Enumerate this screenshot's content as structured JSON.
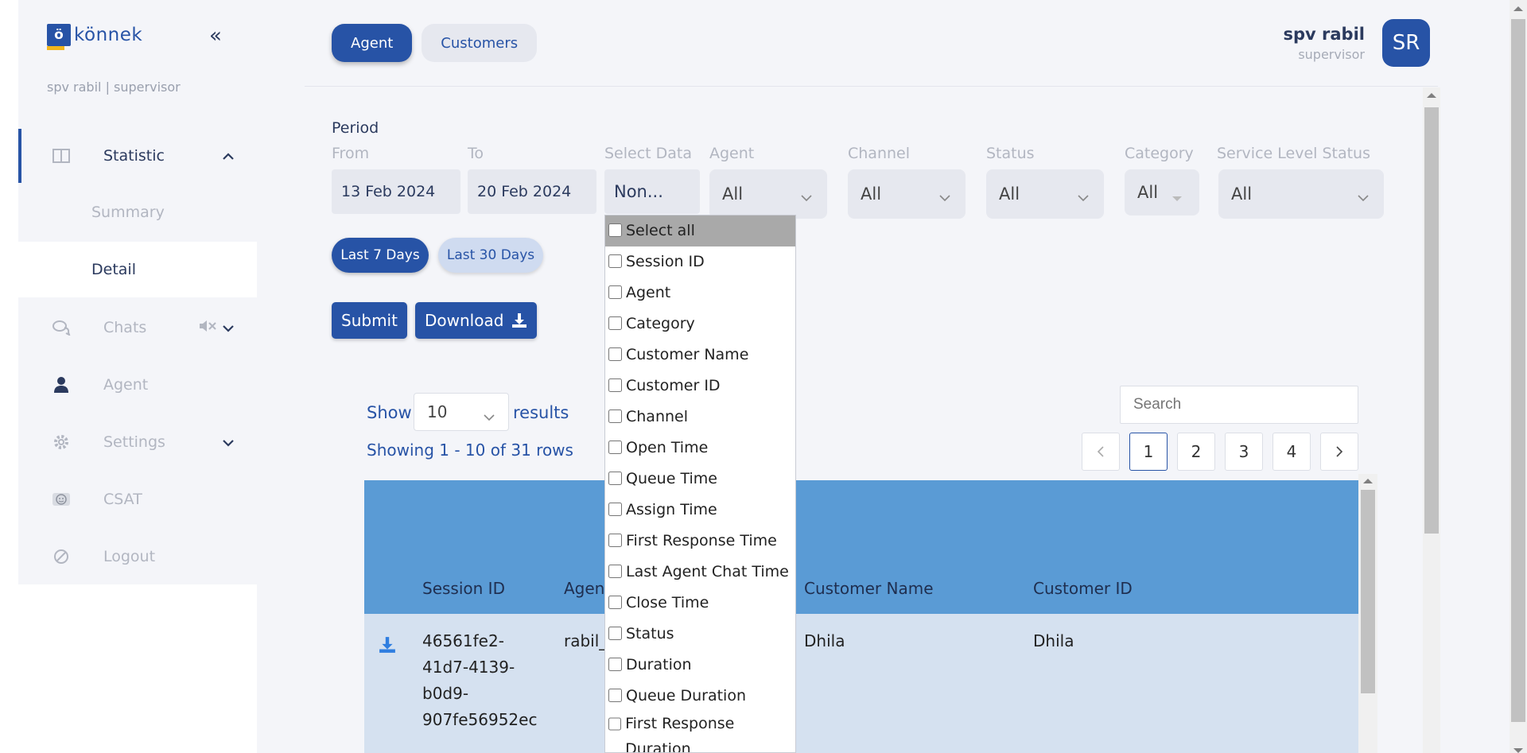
{
  "brand": {
    "name": "könnek",
    "mark": "ö"
  },
  "sidebar": {
    "user_line": "spv rabil | supervisor",
    "items": [
      {
        "label": "Statistic",
        "icon": "columns-icon"
      },
      {
        "label": "Chats",
        "icon": "chat-bubbles-icon"
      },
      {
        "label": "Agent",
        "icon": "person-icon"
      },
      {
        "label": "Settings",
        "icon": "gear-icon"
      },
      {
        "label": "CSAT",
        "icon": "smiley-icon"
      },
      {
        "label": "Logout",
        "icon": "logout-icon"
      }
    ],
    "sub_items": [
      {
        "label": "Summary"
      },
      {
        "label": "Detail"
      }
    ]
  },
  "header": {
    "tabs": [
      {
        "label": "Agent"
      },
      {
        "label": "Customers"
      }
    ],
    "user_name": "spv rabil",
    "user_role": "supervisor",
    "avatar_initials": "SR"
  },
  "filters": {
    "period_label": "Period",
    "from_label": "From",
    "from_value": "13 Feb 2024",
    "to_label": "To",
    "to_value": "20 Feb 2024",
    "select_data_label": "Select Data",
    "select_data_value": "Non...",
    "agent_label": "Agent",
    "agent_value": "All",
    "channel_label": "Channel",
    "channel_value": "All",
    "status_label": "Status",
    "status_value": "All",
    "category_label": "Category",
    "category_value": "All",
    "sls_label": "Service Level Status",
    "sls_value": "All",
    "quick": [
      {
        "label": "Last 7 Days"
      },
      {
        "label": "Last 30 Days"
      }
    ],
    "submit_label": "Submit",
    "download_label": "Download"
  },
  "select_data_options": [
    "Select all",
    "Session ID",
    "Agent",
    "Category",
    "Customer Name",
    "Customer ID",
    "Channel",
    "Open Time",
    "Queue Time",
    "Assign Time",
    "First Response Time",
    "Last Agent Chat Time",
    "Close Time",
    "Status",
    "Duration",
    "Queue Duration",
    "First Response Duration"
  ],
  "table_controls": {
    "show_label": "Show",
    "page_size": "10",
    "results_label": "results",
    "showing_text": "Showing 1 - 10 of 31 rows",
    "search_placeholder": "Search",
    "pages": [
      "1",
      "2",
      "3",
      "4"
    ],
    "current_page": "1"
  },
  "table": {
    "columns": [
      "Session ID",
      "Agen",
      "Customer Name",
      "Customer ID"
    ],
    "rows": [
      {
        "session_id_lines": [
          "46561fe2-",
          "41d7-4139-",
          "b0d9-",
          "907fe56952ec"
        ],
        "agent": "rabil_",
        "customer_name": "Dhila",
        "customer_id": "Dhila"
      }
    ]
  },
  "colors": {
    "primary": "#2753a6",
    "table_header": "#5a9bd5",
    "table_row": "#d5e1f0",
    "background": "#f4f5f9"
  }
}
